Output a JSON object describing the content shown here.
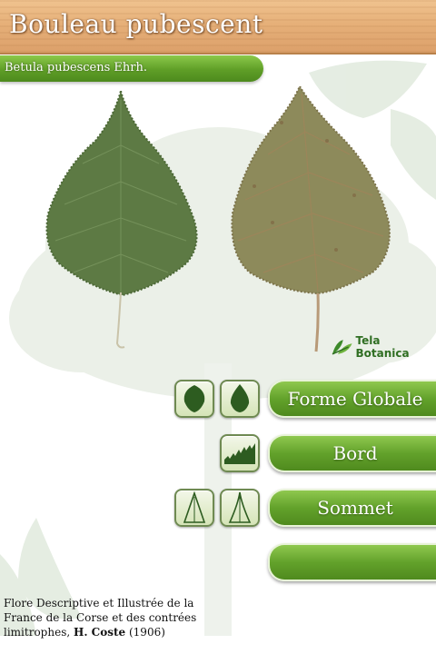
{
  "header": {
    "title": "Bouleau pubescent"
  },
  "latin": {
    "name": "Betula pubescens Ehrh."
  },
  "logo": {
    "text": "Tela Botanica",
    "icon": "leaf-logo-icon"
  },
  "menu": [
    {
      "label": "Forme Globale"
    },
    {
      "label": "Bord"
    },
    {
      "label": "Sommet"
    },
    {
      "label": ""
    }
  ],
  "icons": {
    "row1": [
      "oval-leaf-shape-icon",
      "pointed-leaf-shape-icon"
    ],
    "row2": [
      "serrated-edge-icon"
    ],
    "row3": [
      "acute-apex-icon",
      "acuminate-apex-icon"
    ]
  },
  "credit": {
    "text": "Flore Descriptive et Illustrée de la France de la Corse et des contrées limitrophes, ",
    "author": "H. Coste",
    "year": " (1906)"
  },
  "colors": {
    "wood": "#e6b079",
    "green": "#63a22b",
    "leaf_front": "#5e7a45",
    "leaf_back": "#8e8a5c"
  }
}
